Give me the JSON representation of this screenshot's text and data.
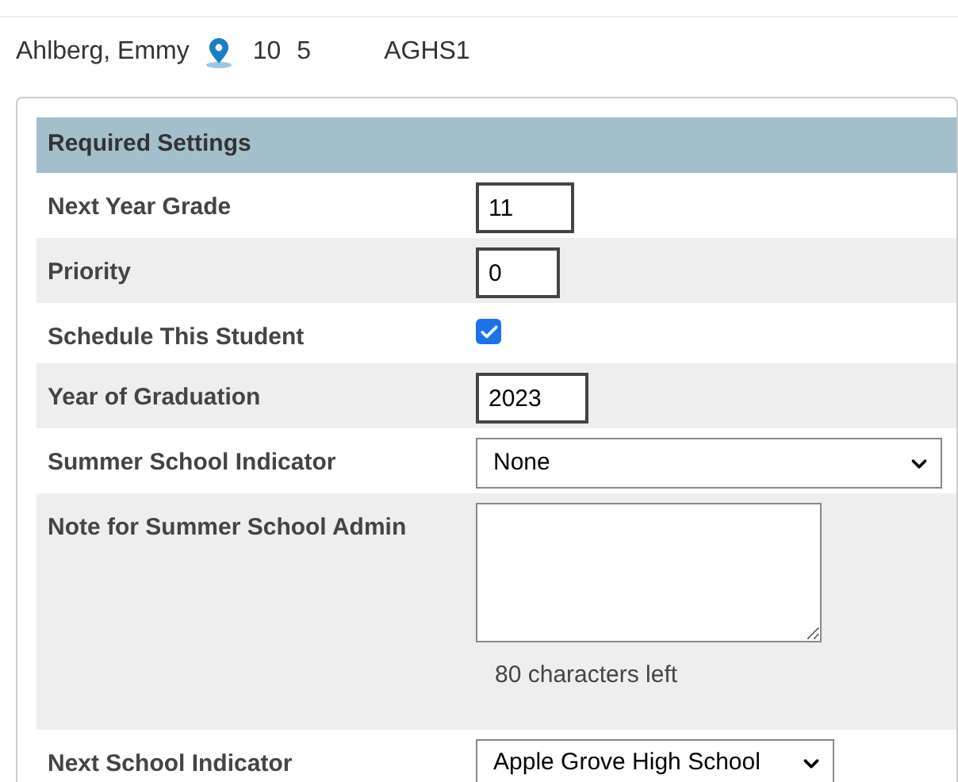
{
  "student": {
    "name": "Ahlberg, Emmy",
    "grade": "10",
    "column_3": "5",
    "school": "AGHS1"
  },
  "section": {
    "title": "Required Settings",
    "rows": [
      {
        "label": "Next Year Grade",
        "kind": "text",
        "value": "11"
      },
      {
        "label": "Priority",
        "kind": "text",
        "value": "0"
      },
      {
        "label": "Schedule This Student",
        "kind": "checkbox",
        "checked": true
      },
      {
        "label": "Year of Graduation",
        "kind": "text",
        "value": "2023"
      },
      {
        "label": "Summer School Indicator",
        "kind": "select",
        "value": "None"
      },
      {
        "label": "Note for Summer School Admin",
        "kind": "textarea",
        "hint": "80 characters left"
      },
      {
        "label": "Next School Indicator",
        "kind": "select",
        "value": "Apple Grove High School"
      }
    ]
  }
}
